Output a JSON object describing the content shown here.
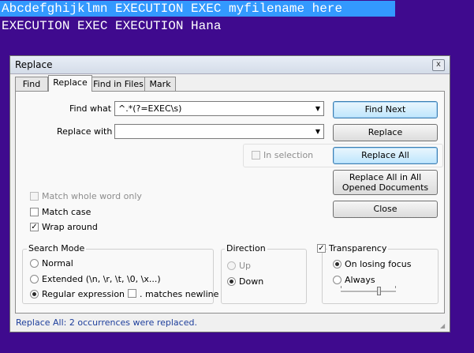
{
  "editor": {
    "line1": "Abcdefghijklmn EXECUTION EXEC myfilename here",
    "line2": "EXECUTION EXEC EXECUTION Hana"
  },
  "dialog": {
    "title": "Replace",
    "close_glyph": "x",
    "tabs": [
      {
        "label": "Find"
      },
      {
        "label": "Replace"
      },
      {
        "label": "Find in Files"
      },
      {
        "label": "Mark"
      }
    ],
    "find_what_label": "Find what :",
    "find_what_value": "^.*(?=EXEC\\s)",
    "replace_with_label": "Replace with :",
    "replace_with_value": "",
    "in_selection_label": "In selection",
    "buttons": {
      "find_next": "Find Next",
      "replace": "Replace",
      "replace_all": "Replace All",
      "replace_all_opened": "Replace All in All Opened Documents",
      "close": "Close"
    },
    "options": {
      "match_whole_word": "Match whole word only",
      "match_case": "Match case",
      "wrap_around": "Wrap around"
    },
    "search_mode": {
      "title": "Search Mode",
      "normal": "Normal",
      "extended": "Extended (\\n, \\r, \\t, \\0, \\x...)",
      "regex": "Regular expression",
      "matches_newline": ". matches newline"
    },
    "direction": {
      "title": "Direction",
      "up": "Up",
      "down": "Down"
    },
    "transparency": {
      "title": "Transparency",
      "on_losing_focus": "On losing focus",
      "always": "Always",
      "level": 0.7
    },
    "status": "Replace All: 2 occurrences were replaced."
  },
  "colors": {
    "editor_bg": "#3f0a8e",
    "selection_bg": "#3399ff",
    "status_text": "#1e3f9c"
  }
}
